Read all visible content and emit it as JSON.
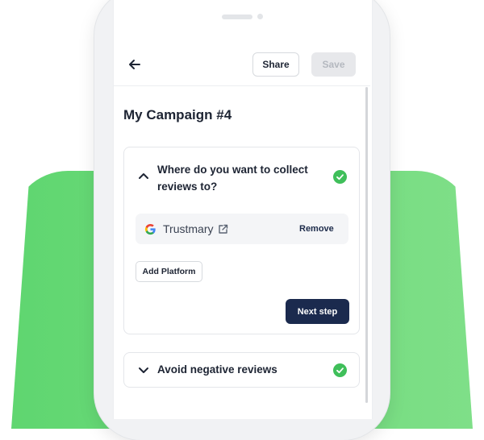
{
  "header": {
    "share_label": "Share",
    "save_label": "Save"
  },
  "campaign": {
    "title": "My Campaign #4"
  },
  "step1": {
    "question": "Where do you want to collect reviews to?",
    "status": "completed",
    "platform": {
      "name": "Trustmary",
      "remove_label": "Remove"
    },
    "add_platform_label": "Add Platform",
    "next_label": "Next step"
  },
  "step2": {
    "title": "Avoid negative reviews",
    "status": "completed"
  },
  "colors": {
    "accent_green": "#5fd670",
    "check_green": "#3fbf5a",
    "primary_navy": "#1b2a4e"
  },
  "icons": [
    "back-arrow-icon",
    "chevron-up-icon",
    "check-circle-icon",
    "google-icon",
    "external-link-icon",
    "chevron-down-icon"
  ]
}
